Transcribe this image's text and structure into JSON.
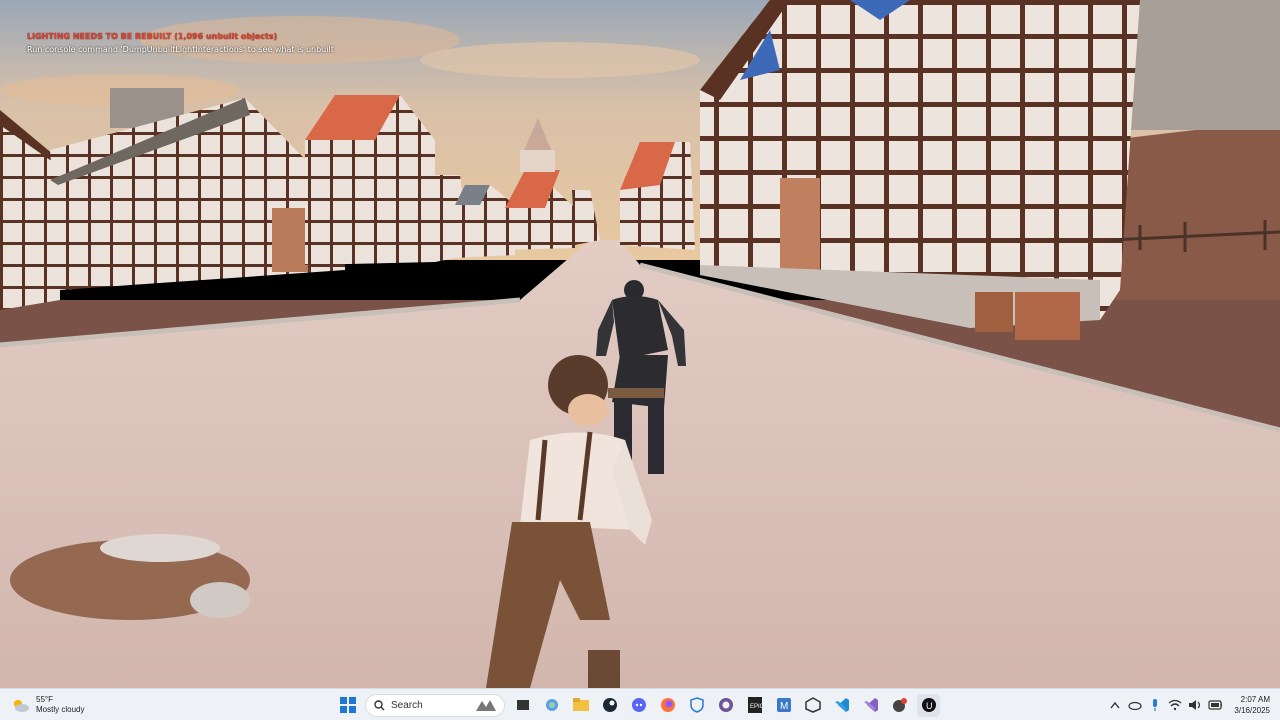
{
  "overlay": {
    "warning": "LIGHTING NEEDS TO BE REBUILT (1,096 unbuilt objects)",
    "hint": "Run console command 'DumpUnbuiltLightInteractions' to see what is unbuilt"
  },
  "taskbar": {
    "weather": {
      "temp": "55°F",
      "condition": "Mostly cloudy",
      "icon": "cloud-sun-icon"
    },
    "search_placeholder": "Search",
    "apps": [
      "windows-start-icon",
      "search-icon",
      "widget-icon",
      "task-view-icon",
      "copilot-icon",
      "file-explorer-icon",
      "steam-icon",
      "discord-icon",
      "firefox-icon",
      "security-icon",
      "github-icon",
      "epic-games-icon",
      "malwarebytes-icon",
      "unity-icon",
      "vscode-icon",
      "visual-studio-icon",
      "app-icon",
      "unreal-engine-icon"
    ],
    "clock": {
      "time": "2:07 AM",
      "date": "3/16/2025"
    },
    "tray": [
      "chevron-up-icon",
      "onedrive-icon",
      "microphone-icon",
      "wifi-icon",
      "volume-icon",
      "battery-icon"
    ]
  },
  "colors": {
    "warning_red": "#e8402a",
    "taskbar_bg": "#eef1f6",
    "ground": "#d8c0b8",
    "roof": "#d86848",
    "timber": "#5a3224"
  }
}
